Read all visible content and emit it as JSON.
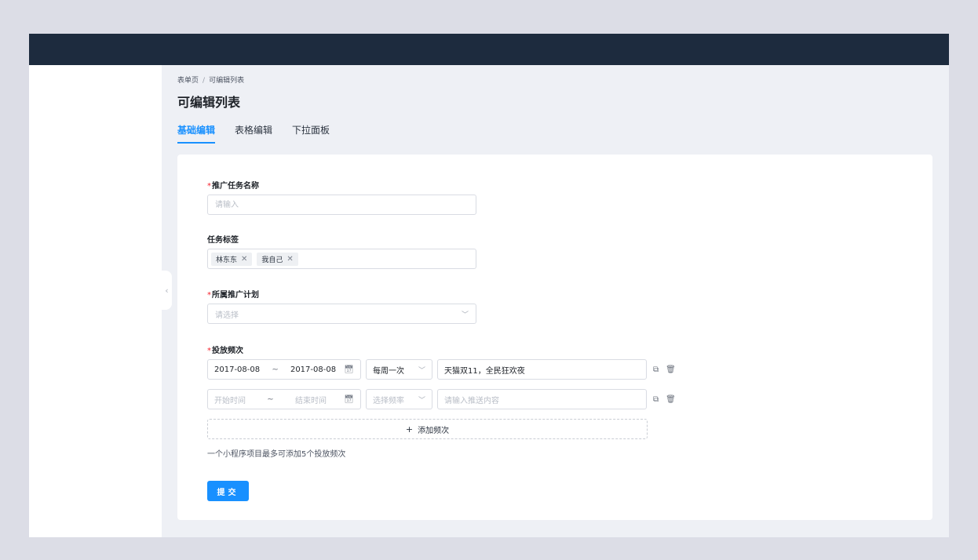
{
  "breadcrumb": [
    "表单页",
    "可编辑列表"
  ],
  "page_title": "可编辑列表",
  "tabs": [
    {
      "label": "基础编辑",
      "active": true
    },
    {
      "label": "表格编辑",
      "active": false
    },
    {
      "label": "下拉面板",
      "active": false
    }
  ],
  "form": {
    "task_name": {
      "label": "推广任务名称",
      "required": true,
      "placeholder": "请输入",
      "value": ""
    },
    "task_tags": {
      "label": "任务标签",
      "tags": [
        "林东东",
        "我自己"
      ]
    },
    "plan": {
      "label": "所属推广计划",
      "required": true,
      "placeholder": "请选择"
    },
    "frequency": {
      "label": "投放频次",
      "required": true,
      "rows": [
        {
          "start": "2017-08-08",
          "end": "2017-08-08",
          "frequency": "每周一次",
          "content": "天猫双11，全民狂欢夜"
        },
        {
          "start_placeholder": "开始时间",
          "end_placeholder": "结束时间",
          "frequency_placeholder": "选择频率",
          "content_placeholder": "请输入推送内容"
        }
      ],
      "separator": "~",
      "add_label": "添加频次",
      "hint": "一个小程序项目最多可添加5个投放频次"
    },
    "submit_label": "提交"
  },
  "colors": {
    "accent": "#1890ff",
    "topbar": "#1d2b3e",
    "required": "#f5222d"
  }
}
